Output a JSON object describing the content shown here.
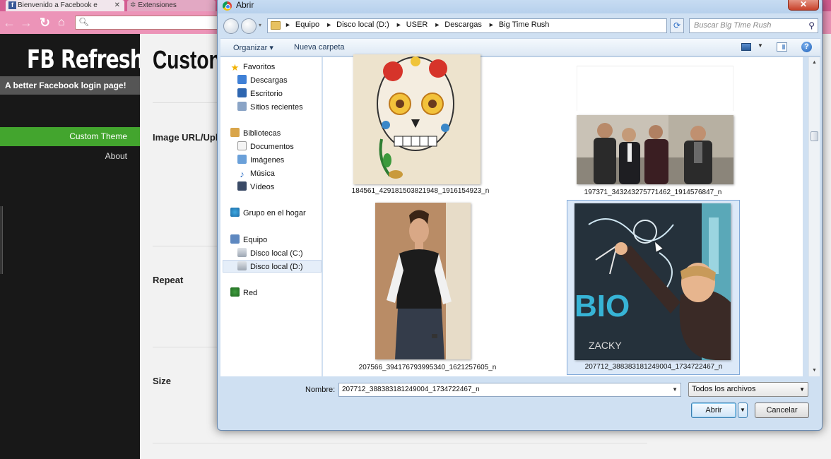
{
  "browser": {
    "tabs": [
      {
        "label": "Bienvenido a Facebook e",
        "close": "✕"
      },
      {
        "label": "Extensiones"
      }
    ],
    "omnibox_icon": "search-icon"
  },
  "sidebar": {
    "brand": "FB Refresh",
    "tagline": "A better Facebook login page!",
    "items": [
      {
        "label": "Custom Theme",
        "active": true
      },
      {
        "label": "About",
        "active": false
      }
    ]
  },
  "content": {
    "title": "Custon",
    "fields": [
      {
        "label": "Image URL/Upl"
      },
      {
        "label": "Repeat"
      },
      {
        "label": "Size"
      }
    ]
  },
  "dialog": {
    "title": "Abrir",
    "close": "✕",
    "breadcrumb": [
      "Equipo",
      "Disco local (D:)",
      "USER",
      "Descargas",
      "Big Time Rush"
    ],
    "search_placeholder": "Buscar Big Time Rush",
    "commands": {
      "organize": "Organizar ▾",
      "new_folder": "Nueva carpeta"
    },
    "nav": {
      "favorites": "Favoritos",
      "downloads": "Descargas",
      "desktop": "Escritorio",
      "recent": "Sitios recientes",
      "libraries": "Bibliotecas",
      "documents": "Documentos",
      "images": "Imágenes",
      "music": "Música",
      "videos": "Vídeos",
      "homegroup": "Grupo en el hogar",
      "computer": "Equipo",
      "drive_c": "Disco local (C:)",
      "drive_d": "Disco local (D:)",
      "network": "Red"
    },
    "files": [
      {
        "name": "184561_429181503821948_1916154923_n",
        "selected": false
      },
      {
        "name": "197371_343243275771462_1914576847_n",
        "selected": false
      },
      {
        "name": "207566_394176793995340_1621257605_n",
        "selected": false
      },
      {
        "name": "207712_388383181249004_1734722467_n",
        "selected": true
      }
    ],
    "filename_label": "Nombre:",
    "filename_value": "207712_388383181249004_1734722467_n",
    "filetype": "Todos los archivos",
    "open_button": "Abrir",
    "cancel_button": "Cancelar"
  },
  "colors": {
    "tabstrip": "#d45d92",
    "toolbar": "#ec94b8",
    "sidebar_active": "#43a52e",
    "dialog_bg": "#cfe0f2"
  }
}
